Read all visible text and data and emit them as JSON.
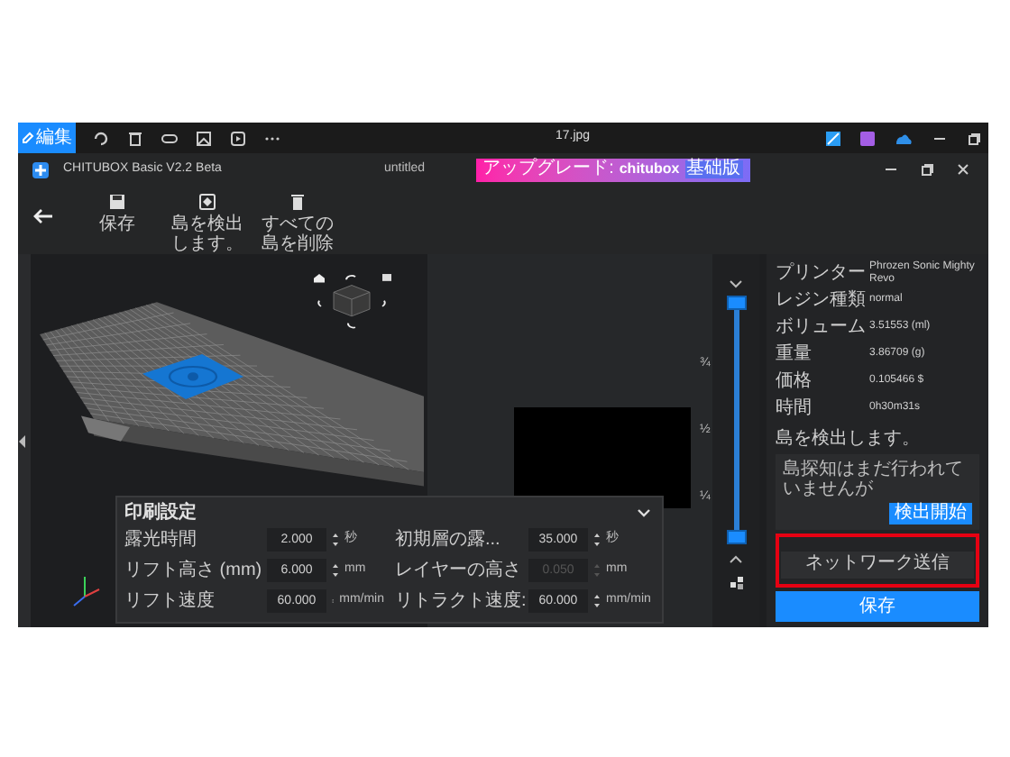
{
  "capture_bar": {
    "edit_button": "編集",
    "file_name": "17.jpg"
  },
  "window": {
    "title": "CHITUBOX Basic V2.2 Beta",
    "document": "untitled",
    "upgrade": {
      "label": "アップグレード:",
      "brand": "chitubox",
      "badge": "基础版"
    }
  },
  "toolbar": [
    {
      "kind": "save",
      "label": "保存"
    },
    {
      "kind": "detect",
      "label": "島を検出します。"
    },
    {
      "kind": "delete",
      "label": "すべての島を削除"
    }
  ],
  "print_settings": {
    "title": "印刷設定",
    "expanded": true,
    "fields": [
      {
        "label": "露光時間",
        "value": "2.000",
        "unit": "秒",
        "disabled": false
      },
      {
        "label": "初期層の露...",
        "value": "35.000",
        "unit": "秒",
        "disabled": false
      },
      {
        "label": "リフト高さ (mm)",
        "value": "6.000",
        "unit": "mm",
        "disabled": false
      },
      {
        "label": "レイヤーの高さ",
        "value": "0.050",
        "unit": "mm",
        "disabled": true
      },
      {
        "label": "リフト速度",
        "value": "60.000",
        "unit": "mm/min",
        "disabled": false
      },
      {
        "label": "リトラクト速度:",
        "value": "60.000",
        "unit": "mm/min",
        "disabled": false
      }
    ]
  },
  "layer_slider": {
    "ticks": [
      "¾",
      "½",
      "¼"
    ],
    "thumbs": [
      {
        "level": 1
      },
      {
        "level": 0
      }
    ]
  },
  "info": [
    {
      "label": "プリンター",
      "value": "Phrozen Sonic Mighty Revo"
    },
    {
      "label": "レジン種類",
      "value": "normal"
    },
    {
      "label": "ボリューム",
      "value": "3.51553 (ml)"
    },
    {
      "label": "重量",
      "value": "3.86709 (g)"
    },
    {
      "label": "価格",
      "value": "0.105466 $"
    },
    {
      "label": "時間",
      "value": "0h30m31s"
    }
  ],
  "island_detection": {
    "title": "島を検出します。",
    "message": "島探知はまだ行われていませんが",
    "button": "検出開始"
  },
  "actions": [
    {
      "kind": "secondary",
      "label": "ネットワーク送信",
      "highlighted": true
    },
    {
      "kind": "primary",
      "label": "保存",
      "highlighted": false
    }
  ]
}
